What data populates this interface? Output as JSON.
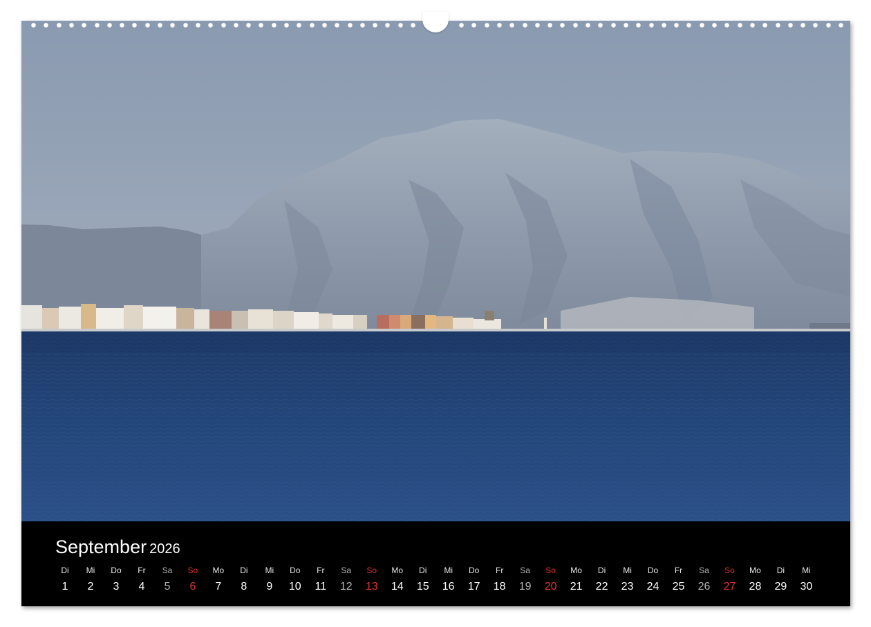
{
  "calendar": {
    "month": "September",
    "year": "2026",
    "days": [
      {
        "wd": "Di",
        "d": "1",
        "type": "weekday"
      },
      {
        "wd": "Mi",
        "d": "2",
        "type": "weekday"
      },
      {
        "wd": "Do",
        "d": "3",
        "type": "weekday"
      },
      {
        "wd": "Fr",
        "d": "4",
        "type": "weekday"
      },
      {
        "wd": "Sa",
        "d": "5",
        "type": "sat"
      },
      {
        "wd": "So",
        "d": "6",
        "type": "sun"
      },
      {
        "wd": "Mo",
        "d": "7",
        "type": "weekday"
      },
      {
        "wd": "Di",
        "d": "8",
        "type": "weekday"
      },
      {
        "wd": "Mi",
        "d": "9",
        "type": "weekday"
      },
      {
        "wd": "Do",
        "d": "10",
        "type": "weekday"
      },
      {
        "wd": "Fr",
        "d": "11",
        "type": "weekday"
      },
      {
        "wd": "Sa",
        "d": "12",
        "type": "sat"
      },
      {
        "wd": "So",
        "d": "13",
        "type": "sun"
      },
      {
        "wd": "Mo",
        "d": "14",
        "type": "weekday"
      },
      {
        "wd": "Di",
        "d": "15",
        "type": "weekday"
      },
      {
        "wd": "Mi",
        "d": "16",
        "type": "weekday"
      },
      {
        "wd": "Do",
        "d": "17",
        "type": "weekday"
      },
      {
        "wd": "Fr",
        "d": "18",
        "type": "weekday"
      },
      {
        "wd": "Sa",
        "d": "19",
        "type": "sat"
      },
      {
        "wd": "So",
        "d": "20",
        "type": "sun"
      },
      {
        "wd": "Mo",
        "d": "21",
        "type": "weekday"
      },
      {
        "wd": "Di",
        "d": "22",
        "type": "weekday"
      },
      {
        "wd": "Mi",
        "d": "23",
        "type": "weekday"
      },
      {
        "wd": "Do",
        "d": "24",
        "type": "weekday"
      },
      {
        "wd": "Fr",
        "d": "25",
        "type": "weekday"
      },
      {
        "wd": "Sa",
        "d": "26",
        "type": "sat"
      },
      {
        "wd": "So",
        "d": "27",
        "type": "sun"
      },
      {
        "wd": "Mo",
        "d": "28",
        "type": "weekday"
      },
      {
        "wd": "Di",
        "d": "29",
        "type": "weekday"
      },
      {
        "wd": "Mi",
        "d": "30",
        "type": "weekday"
      }
    ]
  },
  "colors": {
    "sunday": "#e1322d",
    "saturday": "#b4b4b4",
    "calendar_bg": "#000000",
    "sky": "#8e9db3",
    "sea": "#1f3e70"
  }
}
